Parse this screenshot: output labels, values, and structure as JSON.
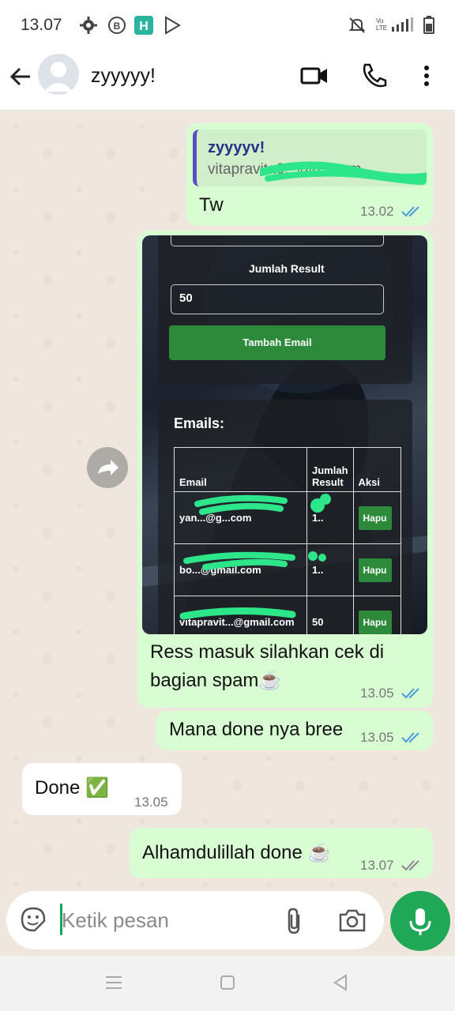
{
  "status_bar": {
    "time": "13.07",
    "network_label": "Vo LTE"
  },
  "header": {
    "contact_name": "zyyyyy!"
  },
  "messages": [
    {
      "quote_name": "zyyyyv!",
      "quote_sub": "vitapravita0...@g...com",
      "text": "Tw",
      "time": "13.02"
    },
    {
      "image": {
        "jumlah_label": "Jumlah Result",
        "jumlah_value": "50",
        "add_button": "Tambah Email",
        "emails_heading": "Emails:",
        "columns": [
          "Email",
          "Jumlah Result",
          "Aksi"
        ],
        "rows": [
          {
            "email": "yan...@g...com",
            "result": "1..",
            "action": "Hapu"
          },
          {
            "email": "bo...@gmail.com",
            "result": "1..",
            "action": "Hapu"
          },
          {
            "email": "vitapravit...@gmail.com",
            "result": "50",
            "action": "Hapu"
          }
        ]
      },
      "text_line1": "Ress masuk silahkan cek di",
      "text_line2": "bagian spam☕",
      "time": "13.05"
    },
    {
      "text": "Mana done nya bree",
      "time": "13.05"
    },
    {
      "text": "Done ✅",
      "time": "13.05"
    },
    {
      "text": "Alhamdulillah done ☕",
      "time": "13.07"
    }
  ],
  "input": {
    "placeholder": "Ketik pesan"
  },
  "colors": {
    "accent": "#1fa855",
    "outgoing_bubble": "#d9fdd3",
    "read_tick": "#4a9ae0"
  }
}
